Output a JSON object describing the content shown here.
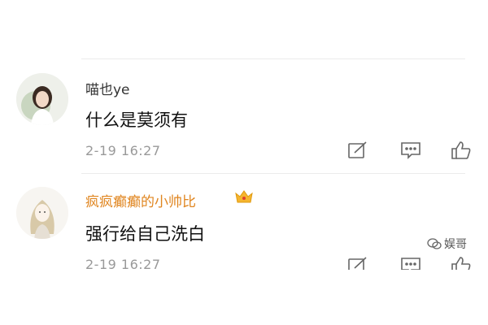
{
  "comments": [
    {
      "username": "喵也ye",
      "text": "什么是莫须有",
      "time": "2-19 16:27",
      "username_color": "#333333"
    },
    {
      "username": "疯疯癫癫的小帅比",
      "text": "强行给自己洗白",
      "time": "2-19 16:27",
      "username_color": "#e0851f",
      "badge": "crown-icon"
    }
  ],
  "actions": [
    "edit-icon",
    "comment-icon",
    "like-icon"
  ],
  "watermark": {
    "text": "娱哥"
  }
}
